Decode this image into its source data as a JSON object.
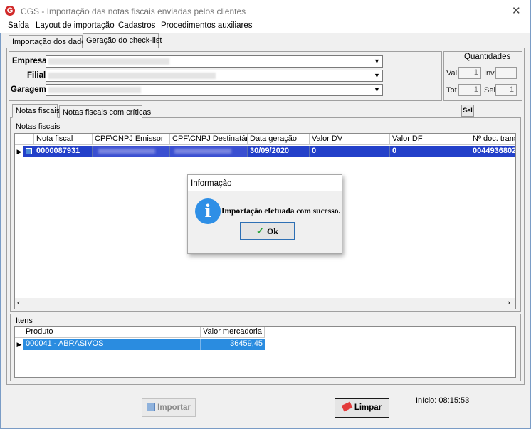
{
  "window": {
    "title": "CGS - Importação das notas fiscais enviadas pelos clientes"
  },
  "menu": [
    "Saída",
    "Layout de importação",
    "Cadastros",
    "Procedimentos auxiliares"
  ],
  "tabs": [
    "Importação dos dados",
    "Geração do check-list"
  ],
  "fields": {
    "empresa": "Empresa",
    "filial": "Filial",
    "garagem": "Garagem"
  },
  "quantidades": {
    "title": "Quantidades",
    "val_label": "Val",
    "val": "1",
    "inv_label": "Inv",
    "inv": "",
    "tot_label": "Tot",
    "tot": "1",
    "sel_label": "Sel",
    "sel": "1"
  },
  "subtabs": [
    "Notas fiscais",
    "Notas fiscais com críticas"
  ],
  "notas": {
    "group_title": "Notas fiscais",
    "columns": [
      "Nota fiscal",
      "CPF\\CNPJ Emissor",
      "CPF\\CNPJ Destinatário",
      "Data geração",
      "Valor DV",
      "Valor DF",
      "Nº doc. trans"
    ],
    "row": {
      "nota": "0000087931",
      "data": "30/09/2020",
      "valor_dv": "0",
      "valor_df": "0",
      "doc_trans": "0044936802"
    }
  },
  "itens": {
    "group_title": "Itens",
    "columns": [
      "Produto",
      "Valor mercadoria"
    ],
    "row": {
      "produto": "000041 - ABRASIVOS",
      "valor": "36459,45"
    }
  },
  "buttons": {
    "importar": "Importar",
    "limpar": "Limpar"
  },
  "status": {
    "inicio": "Início: 08:15:53"
  },
  "dialog": {
    "title": "Informação",
    "message": "Importação efetuada com sucesso.",
    "ok": "Ok"
  }
}
